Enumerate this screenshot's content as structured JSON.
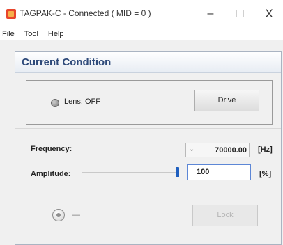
{
  "window": {
    "title": "TAGPAK-C  - Connected ( MID = 0 )",
    "minimize_glyph": "–",
    "close_glyph": "X"
  },
  "menu": {
    "items": [
      "File",
      "Tool",
      "Help"
    ]
  },
  "panel": {
    "title": "Current Condition"
  },
  "lens": {
    "status_text": "Lens: OFF",
    "drive_label": "Drive"
  },
  "frequency": {
    "label": "Frequency:",
    "value": "70000.00",
    "unit": "[Hz]",
    "dropdown_glyph": "⌄"
  },
  "amplitude": {
    "label": "Amplitude:",
    "value": "100",
    "unit": "[%]",
    "slider_level": 1.0
  },
  "bottom": {
    "status_dash": "—",
    "lock_label": "Lock"
  },
  "colors": {
    "accent": "#1f5fbf",
    "panel_title": "#2e4a7a",
    "app_icon": "#e8452c"
  }
}
